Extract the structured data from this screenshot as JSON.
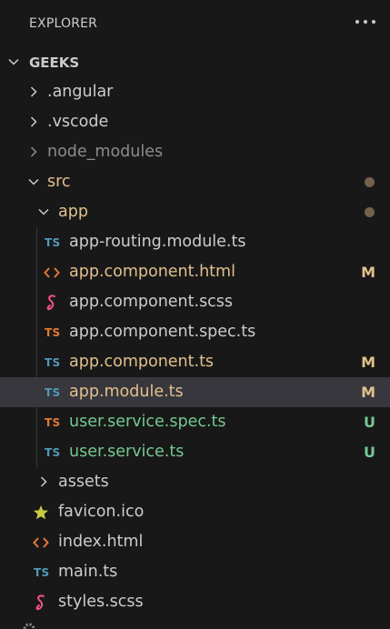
{
  "header": {
    "title": "EXPLORER",
    "more_icon": "ellipsis-icon"
  },
  "root": {
    "label": "GEEKS",
    "expanded": true
  },
  "colors": {
    "modified": "#e2c08d",
    "untracked": "#73c991",
    "ignored": "#8c8c8c",
    "default": "#cccccc",
    "ts_blue": "#519aba",
    "ts_orange": "#e37933",
    "html_orange": "#e37933",
    "scss_pink": "#f55385",
    "favicon_star": "#cbcb41",
    "dot": "#73624a",
    "selected_bg": "#37373d"
  },
  "tree": [
    {
      "label": ".angular",
      "kind": "folder",
      "expanded": false,
      "status": ""
    },
    {
      "label": ".vscode",
      "kind": "folder",
      "expanded": false,
      "status": ""
    },
    {
      "label": "node_modules",
      "kind": "folder",
      "expanded": false,
      "status": "ignored"
    },
    {
      "label": "src",
      "kind": "folder",
      "expanded": true,
      "status": "dot"
    },
    {
      "label": "app",
      "kind": "folder",
      "expanded": true,
      "status": "dot"
    },
    {
      "label": "app-routing.module.ts",
      "kind": "file",
      "icon": "TS",
      "icon_name": "typescript-icon",
      "status": ""
    },
    {
      "label": "app.component.html",
      "kind": "file",
      "icon": "<>",
      "icon_name": "html-icon",
      "status": "M"
    },
    {
      "label": "app.component.scss",
      "kind": "file",
      "icon": "scss",
      "icon_name": "scss-icon",
      "status": ""
    },
    {
      "label": "app.component.spec.ts",
      "kind": "file",
      "icon": "TS",
      "icon_name": "typescript-spec-icon",
      "status": ""
    },
    {
      "label": "app.component.ts",
      "kind": "file",
      "icon": "TS",
      "icon_name": "typescript-icon",
      "status": "M"
    },
    {
      "label": "app.module.ts",
      "kind": "file",
      "icon": "TS",
      "icon_name": "typescript-icon",
      "status": "M",
      "selected": true
    },
    {
      "label": "user.service.spec.ts",
      "kind": "file",
      "icon": "TS",
      "icon_name": "typescript-spec-icon",
      "status": "U"
    },
    {
      "label": "user.service.ts",
      "kind": "file",
      "icon": "TS",
      "icon_name": "typescript-icon",
      "status": "U"
    },
    {
      "label": "assets",
      "kind": "folder",
      "expanded": false,
      "status": ""
    },
    {
      "label": "favicon.ico",
      "kind": "file",
      "icon": "star",
      "icon_name": "favicon-star-icon",
      "status": ""
    },
    {
      "label": "index.html",
      "kind": "file",
      "icon": "<>",
      "icon_name": "html-icon",
      "status": ""
    },
    {
      "label": "main.ts",
      "kind": "file",
      "icon": "TS",
      "icon_name": "typescript-icon",
      "status": ""
    },
    {
      "label": "styles.scss",
      "kind": "file",
      "icon": "scss",
      "icon_name": "scss-icon",
      "status": ""
    }
  ]
}
